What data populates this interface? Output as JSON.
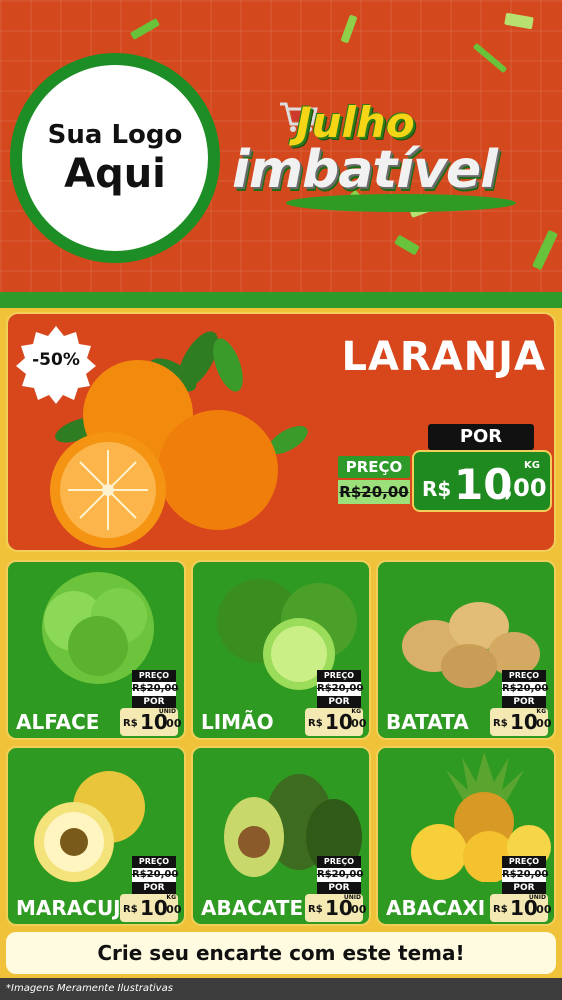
{
  "logo": {
    "line1": "Sua Logo",
    "line2": "Aqui"
  },
  "title": {
    "line1": "Julho",
    "line2": "imbatível"
  },
  "hero": {
    "product": "LARANJA",
    "discount_badge": "-50%",
    "preco_label": "PREÇO",
    "old_price": "R$20,00",
    "por_label": "POR",
    "currency": "R$",
    "price_int": "10",
    "price_dec": ",00",
    "unit": "KG"
  },
  "products": [
    {
      "name": "ALFACE",
      "preco_label": "PREÇO",
      "old_price": "R$20,00",
      "por_label": "POR",
      "currency": "R$",
      "price_int": "10",
      "price_dec": ",00",
      "unit": "UNID"
    },
    {
      "name": "LIMÃO",
      "preco_label": "PREÇO",
      "old_price": "R$20,00",
      "por_label": "POR",
      "currency": "R$",
      "price_int": "10",
      "price_dec": ",00",
      "unit": "KG"
    },
    {
      "name": "BATATA",
      "preco_label": "PREÇO",
      "old_price": "R$20,00",
      "por_label": "POR",
      "currency": "R$",
      "price_int": "10",
      "price_dec": ",00",
      "unit": "KG"
    },
    {
      "name": "MARACUJÁ",
      "preco_label": "PREÇO",
      "old_price": "R$20,00",
      "por_label": "POR",
      "currency": "R$",
      "price_int": "10",
      "price_dec": ",00",
      "unit": "KG"
    },
    {
      "name": "ABACATE",
      "preco_label": "PREÇO",
      "old_price": "R$20,00",
      "por_label": "POR",
      "currency": "R$",
      "price_int": "10",
      "price_dec": ",00",
      "unit": "UNID"
    },
    {
      "name": "ABACAXI",
      "preco_label": "PREÇO",
      "old_price": "R$20,00",
      "por_label": "POR",
      "currency": "R$",
      "price_int": "10",
      "price_dec": ",00",
      "unit": "UNID"
    }
  ],
  "cta": "Crie seu encarte com este tema!",
  "footer": "*Imagens Meramente Ilustrativas",
  "colors": {
    "header_red": "#d4481e",
    "green": "#2f9a22",
    "yellow": "#f0c23a",
    "title_yellow": "#f6d516"
  }
}
